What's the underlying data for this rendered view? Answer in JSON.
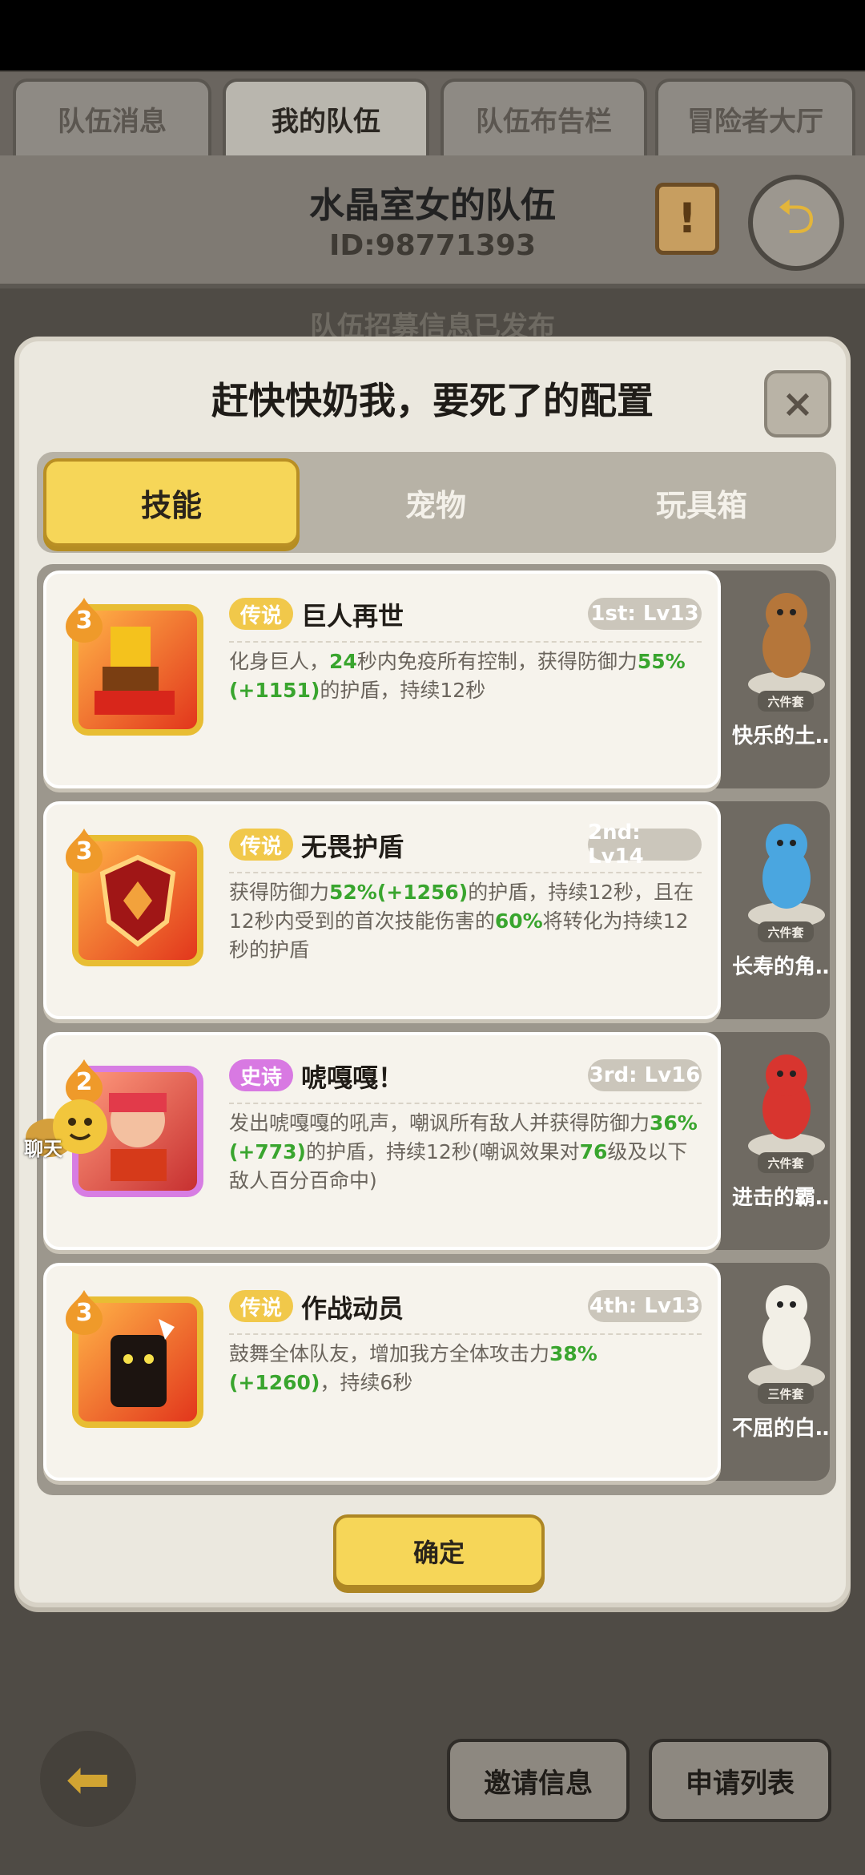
{
  "top_tabs": [
    "队伍消息",
    "我的队伍",
    "队伍布告栏",
    "冒险者大厅"
  ],
  "active_top_tab": 1,
  "team": {
    "name": "水晶室女的队伍",
    "id": "ID:98771393",
    "notice": "队伍招募信息已发布"
  },
  "modal": {
    "title": "赶快快奶我，要死了的配置",
    "close_symbol": "×",
    "tabs": [
      "技能",
      "宠物",
      "玩具箱"
    ],
    "active_tab": 0,
    "confirm_label": "确定"
  },
  "skills": [
    {
      "level": "3",
      "rarity": "传说",
      "name": "巨人再世",
      "slot": "1st: Lv13",
      "desc_parts": [
        "化身巨人，",
        "24",
        "秒内免疫所有控制，获得防御力",
        "55%(+1151)",
        "的护盾，持续12秒"
      ],
      "icon": "giant-icon",
      "pet_name": "快乐的土…",
      "pet_badge": "六件套"
    },
    {
      "level": "3",
      "rarity": "传说",
      "name": "无畏护盾",
      "slot": "2nd: Lv14",
      "desc_parts": [
        "获得防御力",
        "52%(+1256)",
        "的护盾，持续12秒，且在12秒内受到的首次技能伤害的",
        "60%",
        "将转化为持续12秒的护盾"
      ],
      "icon": "shield-icon",
      "pet_name": "长寿的角…",
      "pet_badge": "六件套"
    },
    {
      "level": "2",
      "rarity": "史诗",
      "name": "唬嘎嘎！",
      "slot": "3rd: Lv16",
      "desc_parts": [
        "发出唬嘎嘎的吼声，嘲讽所有敌人并获得防御力",
        "36%(+773)",
        "的护盾，持续12秒(嘲讽效果对",
        "76",
        "级及以下敌人百分百命中)"
      ],
      "icon": "roar-icon",
      "pet_name": "进击的霸…",
      "pet_badge": "六件套"
    },
    {
      "level": "3",
      "rarity": "传说",
      "name": "作战动员",
      "slot": "4th: Lv13",
      "desc_parts": [
        "鼓舞全体队友，增加我方全体攻击力",
        "38%(+1260)",
        "，持续6秒"
      ],
      "icon": "mobilize-icon",
      "pet_name": "不屈的白…",
      "pet_badge": "三件套"
    }
  ],
  "chat_label": "聊天",
  "bottom": {
    "invite_label": "邀请信息",
    "apply_label": "申请列表"
  },
  "colors": {
    "highlight_green": "#39a52e",
    "legend_gold": "#f1c84a",
    "epic_purple": "#d879e2",
    "button_yellow": "#f6d658"
  }
}
